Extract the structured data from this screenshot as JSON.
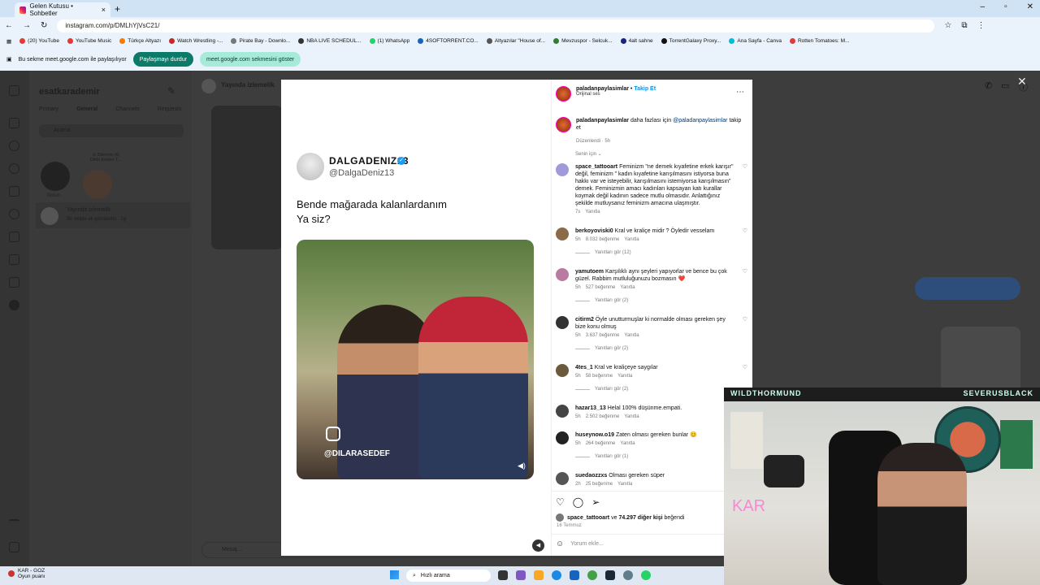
{
  "browser": {
    "tab_title": "Gelen Kutusu • Sohbetler",
    "url": "instagram.com/p/DMLhYjVsC21/",
    "bookmarks": [
      "(20) YouTube",
      "YouTube Music",
      "Türkçe Altyazı",
      "Watch Wrestling -...",
      "Pirate Bay - Downlo...",
      "NBA LIVE SCHEDUL...",
      "(1) WhatsApp",
      "4SOFTORRENT.CO...",
      "Altyazılar \"House of...",
      "Mevzuspor - Selcuk...",
      "4alt sahne",
      "TorrentGalaxy Proxy...",
      "Ana Sayfa - Canva",
      "Rotten Tomatoes: M..."
    ],
    "share_text": "Bu sekme meet.google.com ile paylaşılıyor",
    "share_stop": "Paylaşmayı durdur",
    "share_show": "meet.google.com sekmesini göster"
  },
  "dm": {
    "username": "esatkarademir",
    "tabs": [
      "Primary",
      "General",
      "Channels",
      "Requests"
    ],
    "search_placeholder": "Arama",
    "note_label": "Notun",
    "note2": "⊘ Dilermin Kt",
    "note2_sub": "Dikkt Keden T...",
    "thread_name": "Yayında izlemelik",
    "thread_preview": "Bir ekiple ek gönderdin · 1g",
    "header_name": "Yayında izlemelik",
    "message_placeholder": "Mesaj..."
  },
  "post": {
    "tweet_name": "DALGADENIZ13",
    "tweet_handle": "@DalgaDeniz13",
    "tweet_line1": "Bende mağarada kalanlardanım",
    "tweet_line2": "Ya siz?",
    "video_tag": "@DILARASEDEF",
    "author": "paladanpaylasimlar",
    "follow": "Takip Et",
    "audio": "Orijinal ses",
    "caption_user": "paladanpaylasimlar",
    "caption_text": "daha fazlası için",
    "caption_mention": "@paladanpaylasimlar",
    "caption_tail": "takip et",
    "caption_meta": "Düzenlendi · 5h",
    "sort": "Senin için",
    "comments": [
      {
        "user": "space_tattooart",
        "text": "Feminizm \"ne demek kıyafetine erkek karışır\" değil, feminizm \" kadın kıyafetine karışılmasını istiyorsa buna hakkı var ve isteyebilir, karışılmasını istemiyorsa karışılmasın\" demek. Feminizmin amacı kadınları kapsayan katı kurallar koymak değil kadının sadece mutlu olmasıdır. Anlattığınız şekilde mutluysanız feminizm amacına ulaşmıştır.",
        "time": "7s",
        "likes": "",
        "reply": "Yanıtla",
        "replies": ""
      },
      {
        "user": "berkoyoviski0",
        "text": "Kral ve kraliçe midir ? Öyledir vesselam",
        "time": "5h",
        "likes": "8.032 beğenme",
        "reply": "Yanıtla",
        "replies": "Yanıtları gör (12)"
      },
      {
        "user": "yamutoem",
        "text": "Karşılıklı aynı şeyleri yapıyorlar ve bence bu çok güzel. Rabbim mutluluğunuzu bozmasın ❤️",
        "time": "5h",
        "likes": "527 beğenme",
        "reply": "Yanıtla",
        "replies": "Yanıtları gör (2)"
      },
      {
        "user": "citirm2",
        "text": "Öyle unutturmuşlar ki normalde olması gereken şey bize konu olmuş",
        "time": "5h",
        "likes": "3.637 beğenme",
        "reply": "Yanıtla",
        "replies": "Yanıtları gör (2)"
      },
      {
        "user": "4tes_1",
        "text": "Kral ve kraliçeye saygılar",
        "time": "5h",
        "likes": "58 beğenme",
        "reply": "Yanıtla",
        "replies": "Yanıtları gör (2)"
      },
      {
        "user": "hazar13_13",
        "text": "Helal 100% düşünme.empati.",
        "time": "5h",
        "likes": "2.502 beğenme",
        "reply": "Yanıtla",
        "replies": ""
      },
      {
        "user": "huseynow.o19",
        "text": "Zaten olması gereken bunlar 😊",
        "time": "5h",
        "likes": "264 beğenme",
        "reply": "Yanıtla",
        "replies": "Yanıtları gör (1)"
      },
      {
        "user": "suedaozzxs",
        "text": "Olması gereken süper",
        "time": "2h",
        "likes": "25 beğenme",
        "reply": "Yanıtla",
        "replies": ""
      }
    ],
    "liked_by_user": "space_tattooart",
    "liked_by_mid": "ve",
    "liked_by_count": "74.297 diğer kişi",
    "liked_by_tail": "beğendi",
    "date": "16 Temmuz",
    "add_comment": "Yorum ekle..."
  },
  "webcam": {
    "left_title": "WILDTHORMUND",
    "right_title": "SEVERUSBLACK",
    "overlay": "KAR"
  },
  "taskbar": {
    "app_label": "KAR - GOZ",
    "app_sub": "Oyun puanı",
    "search_placeholder": "Hızlı arama"
  }
}
